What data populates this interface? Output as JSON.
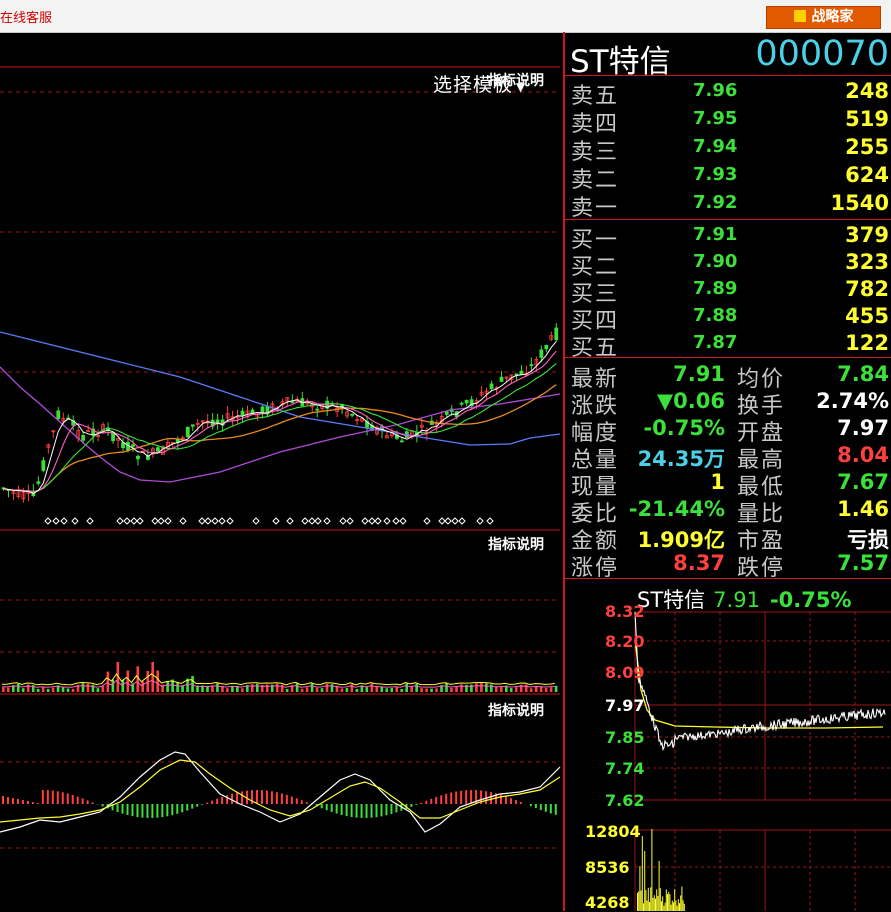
{
  "topbar": {
    "service_label": "在线客服",
    "strategist_label": "战略家"
  },
  "left_panel": {
    "template_label": "选择模板",
    "indicator_label": "指标说明"
  },
  "stock": {
    "name": "ST特信",
    "code": "000070"
  },
  "sell_orders": [
    {
      "label": "卖五",
      "price": "7.96",
      "volume": "248"
    },
    {
      "label": "卖四",
      "price": "7.95",
      "volume": "519"
    },
    {
      "label": "卖三",
      "price": "7.94",
      "volume": "255"
    },
    {
      "label": "卖二",
      "price": "7.93",
      "volume": "624"
    },
    {
      "label": "卖一",
      "price": "7.92",
      "volume": "1540"
    }
  ],
  "buy_orders": [
    {
      "label": "买一",
      "price": "7.91",
      "volume": "379"
    },
    {
      "label": "买二",
      "price": "7.90",
      "volume": "323"
    },
    {
      "label": "买三",
      "price": "7.89",
      "volume": "782"
    },
    {
      "label": "买四",
      "price": "7.88",
      "volume": "455"
    },
    {
      "label": "买五",
      "price": "7.87",
      "volume": "122"
    }
  ],
  "stats": [
    {
      "l1": "最新",
      "v1": "7.91",
      "c1": "g",
      "l2": "均价",
      "v2": "7.84",
      "c2": "g"
    },
    {
      "l1": "涨跌",
      "v1": "▼0.06",
      "c1": "g",
      "l2": "换手",
      "v2": "2.74%",
      "c2": "w"
    },
    {
      "l1": "幅度",
      "v1": "-0.75%",
      "c1": "g",
      "l2": "开盘",
      "v2": "7.97",
      "c2": "w"
    },
    {
      "l1": "总量",
      "v1": "24.35万",
      "c1": "c",
      "l2": "最高",
      "v2": "8.04",
      "c2": "r"
    },
    {
      "l1": "现量",
      "v1": "1",
      "c1": "y",
      "l2": "最低",
      "v2": "7.67",
      "c2": "g"
    },
    {
      "l1": "委比",
      "v1": "-21.44%",
      "c1": "g",
      "l2": "量比",
      "v2": "1.46",
      "c2": "y"
    },
    {
      "l1": "金额",
      "v1": "1.909亿",
      "c1": "y",
      "l2": "市盈",
      "v2": "亏损",
      "c2": "w"
    },
    {
      "l1": "涨停",
      "v1": "8.37",
      "c1": "r",
      "l2": "跌停",
      "v2": "7.57",
      "c2": "g"
    }
  ],
  "intraday": {
    "title": "ST特信",
    "price": "7.91",
    "change": "-0.75%",
    "y_labels": [
      "8.32",
      "8.20",
      "8.09",
      "7.97",
      "7.85",
      "7.74",
      "7.62"
    ],
    "vol_labels": [
      "12804",
      "8536",
      "4268"
    ]
  }
}
